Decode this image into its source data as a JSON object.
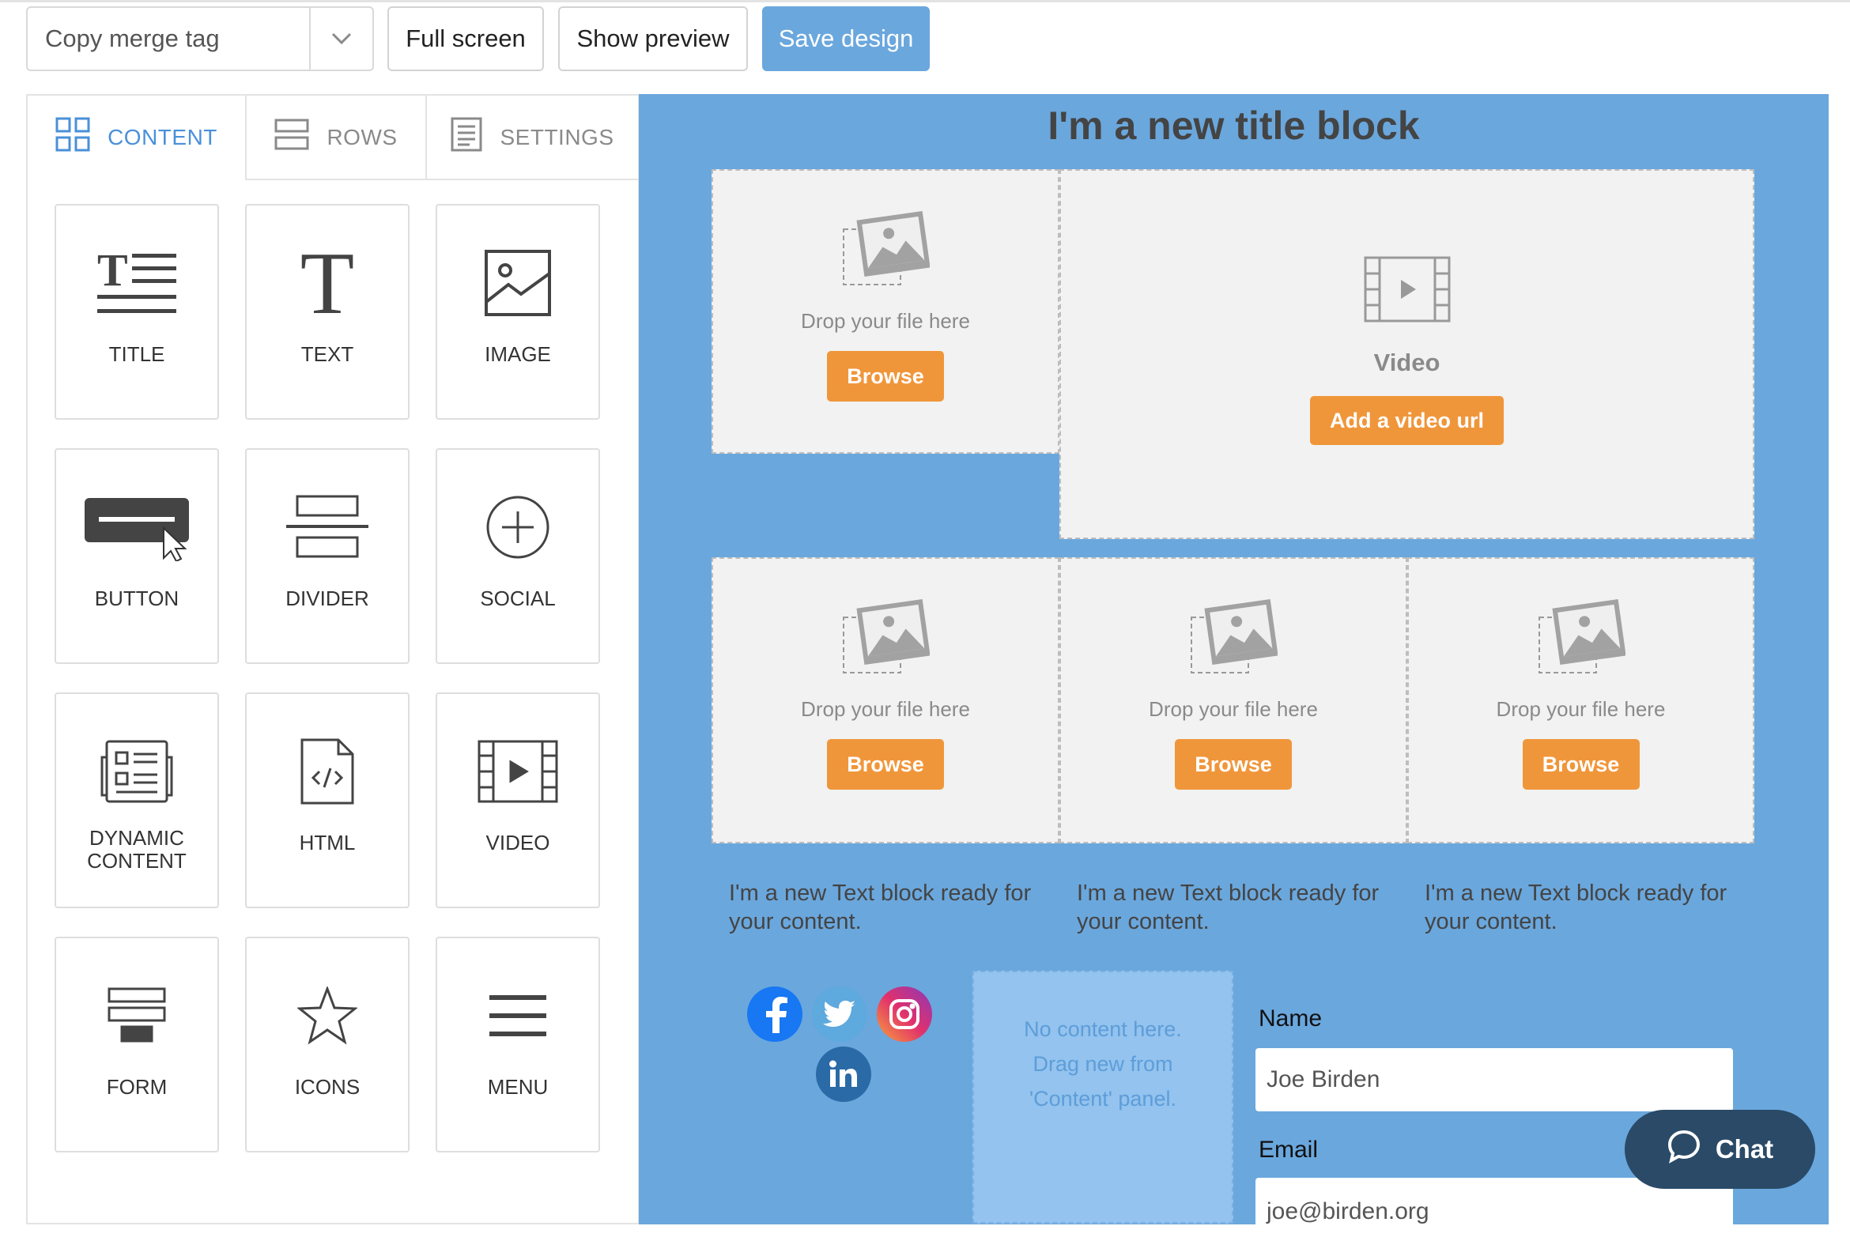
{
  "toolbar": {
    "merge_tag_value": "Copy merge tag",
    "full_screen_label": "Full screen",
    "show_preview_label": "Show preview",
    "save_design_label": "Save design"
  },
  "panel_tabs": [
    {
      "label": "CONTENT",
      "icon": "grid-icon",
      "active": true
    },
    {
      "label": "ROWS",
      "icon": "rows-icon",
      "active": false
    },
    {
      "label": "SETTINGS",
      "icon": "settings-doc-icon",
      "active": false
    }
  ],
  "content_blocks": [
    {
      "label": "TITLE",
      "icon": "title-icon"
    },
    {
      "label": "TEXT",
      "icon": "text-icon"
    },
    {
      "label": "IMAGE",
      "icon": "image-icon"
    },
    {
      "label": "BUTTON",
      "icon": "button-icon"
    },
    {
      "label": "DIVIDER",
      "icon": "divider-icon"
    },
    {
      "label": "SOCIAL",
      "icon": "social-icon"
    },
    {
      "label": "DYNAMIC\nCONTENT",
      "icon": "dynamic-content-icon"
    },
    {
      "label": "HTML",
      "icon": "html-icon"
    },
    {
      "label": "VIDEO",
      "icon": "video-icon"
    },
    {
      "label": "FORM",
      "icon": "form-icon"
    },
    {
      "label": "ICONS",
      "icon": "star-icon"
    },
    {
      "label": "MENU",
      "icon": "menu-icon"
    }
  ],
  "canvas": {
    "title": "I'm a new title block",
    "drop_text": "Drop your file here",
    "browse_label": "Browse",
    "video_title": "Video",
    "video_button": "Add a video url",
    "text_block": "I'm a new Text block ready for your content.",
    "empty_column_text": "No content here. Drag new from 'Content' panel.",
    "form": {
      "name_label": "Name",
      "name_value": "Joe Birden",
      "email_label": "Email",
      "email_value": "joe@birden.org"
    }
  },
  "chat_label": "Chat",
  "colors": {
    "canvas_bg": "#6aa7dd",
    "accent_orange": "#f0963a",
    "accent_blue": "#4a90d9",
    "chat_bg": "#2a4a67"
  }
}
